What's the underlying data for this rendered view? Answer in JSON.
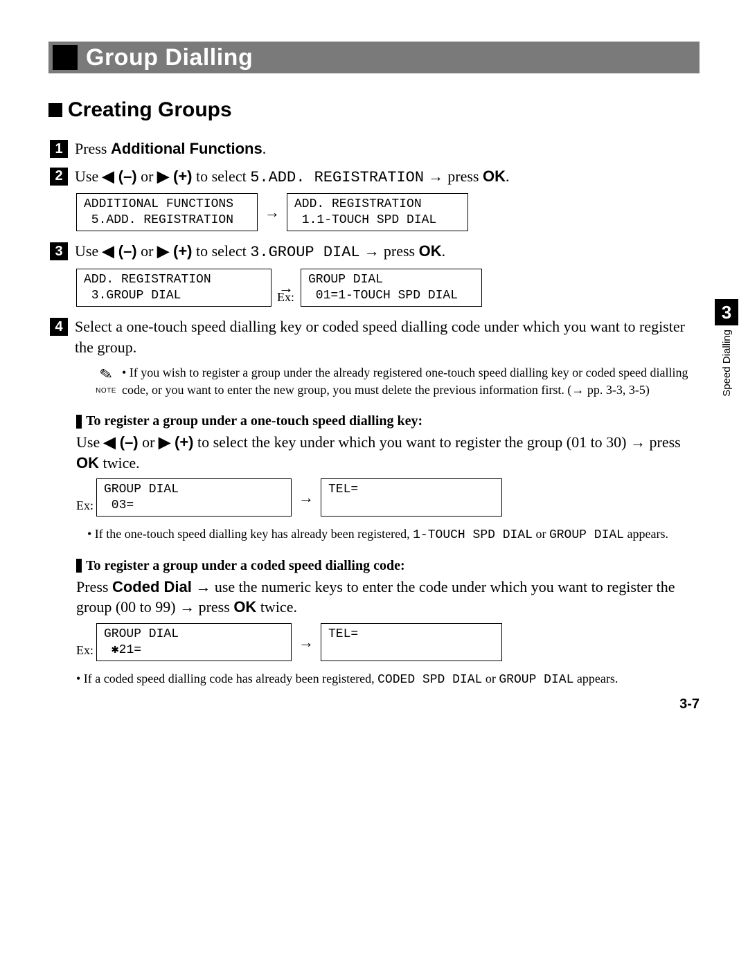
{
  "title_bar": {
    "title": "Group Dialling"
  },
  "section": {
    "heading": "Creating Groups"
  },
  "side_tab": {
    "number": "3",
    "label": "Speed Dialling"
  },
  "page_number": "3-7",
  "step1": {
    "prefix": "Press ",
    "bold": "Additional Functions",
    "suffix": "."
  },
  "step2": {
    "prefix": "Use ",
    "left": "◀ (–)",
    "or": " or ",
    "right": "▶ (+)",
    "mid": " to select ",
    "code": "5.ADD. REGISTRATION",
    "arrow": " → ",
    "press": "press ",
    "ok": "OK",
    "suffix": ".",
    "screen_a_l1": "ADDITIONAL FUNCTIONS",
    "screen_a_l2": " 5.ADD. REGISTRATION",
    "screen_b_l1": "ADD. REGISTRATION",
    "screen_b_l2": " 1.1-TOUCH SPD DIAL"
  },
  "step3": {
    "prefix": "Use ",
    "left": "◀ (–)",
    "or": " or ",
    "right": "▶ (+)",
    "mid": " to select ",
    "code": "3.GROUP DIAL",
    "arrow": " → ",
    "press": "press ",
    "ok": "OK",
    "suffix": ".",
    "screen_a_l1": "ADD. REGISTRATION",
    "screen_a_l2": " 3.GROUP DIAL",
    "ex_label": "Ex:",
    "screen_b_l1": "GROUP DIAL",
    "screen_b_l2": " 01=1-TOUCH SPD DIAL"
  },
  "step4": {
    "text": "Select a one-touch speed dialling key or coded speed dialling code under which you want to register the group."
  },
  "note": {
    "label": "NOTE",
    "text": "• If you wish to register a group under the already registered one-touch speed dialling key or coded speed dialling code, or you want to enter the new group, you must delete the previous information first. (→ pp. 3-3, 3-5)"
  },
  "sub_a": {
    "heading": "To register a group under a one-touch speed dialling key:",
    "p_prefix": "Use ",
    "left": "◀ (–)",
    "or": " or ",
    "right": "▶ (+)",
    "mid": " to select the key under which you want to register the group (01 to 30) → press ",
    "ok": "OK",
    "suffix": " twice.",
    "ex_label": "Ex:",
    "screen_a_l1": "GROUP DIAL",
    "screen_a_l2": " 03=",
    "screen_b_l1": "TEL=",
    "screen_b_l2": " ",
    "footnote_pre": "• If the one-touch speed dialling key has already been registered, ",
    "footnote_code1": "1-TOUCH SPD DIAL",
    "footnote_mid": " or ",
    "footnote_code2": "GROUP DIAL",
    "footnote_post": " appears."
  },
  "sub_b": {
    "heading": "To register a group under a coded speed dialling code:",
    "p_prefix": "Press ",
    "bold": "Coded Dial",
    "p_mid": " → use the numeric keys to enter the code under which you want to register the group (00 to 99) → press ",
    "ok": "OK",
    "suffix": " twice.",
    "ex_label": "Ex:",
    "screen_a_l1": "GROUP DIAL",
    "screen_a_l2": " ✱21=",
    "screen_b_l1": "TEL=",
    "screen_b_l2": " ",
    "footnote_pre": "• If a coded speed dialling code has already been registered, ",
    "footnote_code1": "CODED SPD DIAL",
    "footnote_mid": " or ",
    "footnote_code2": "GROUP DIAL",
    "footnote_post": " appears."
  }
}
